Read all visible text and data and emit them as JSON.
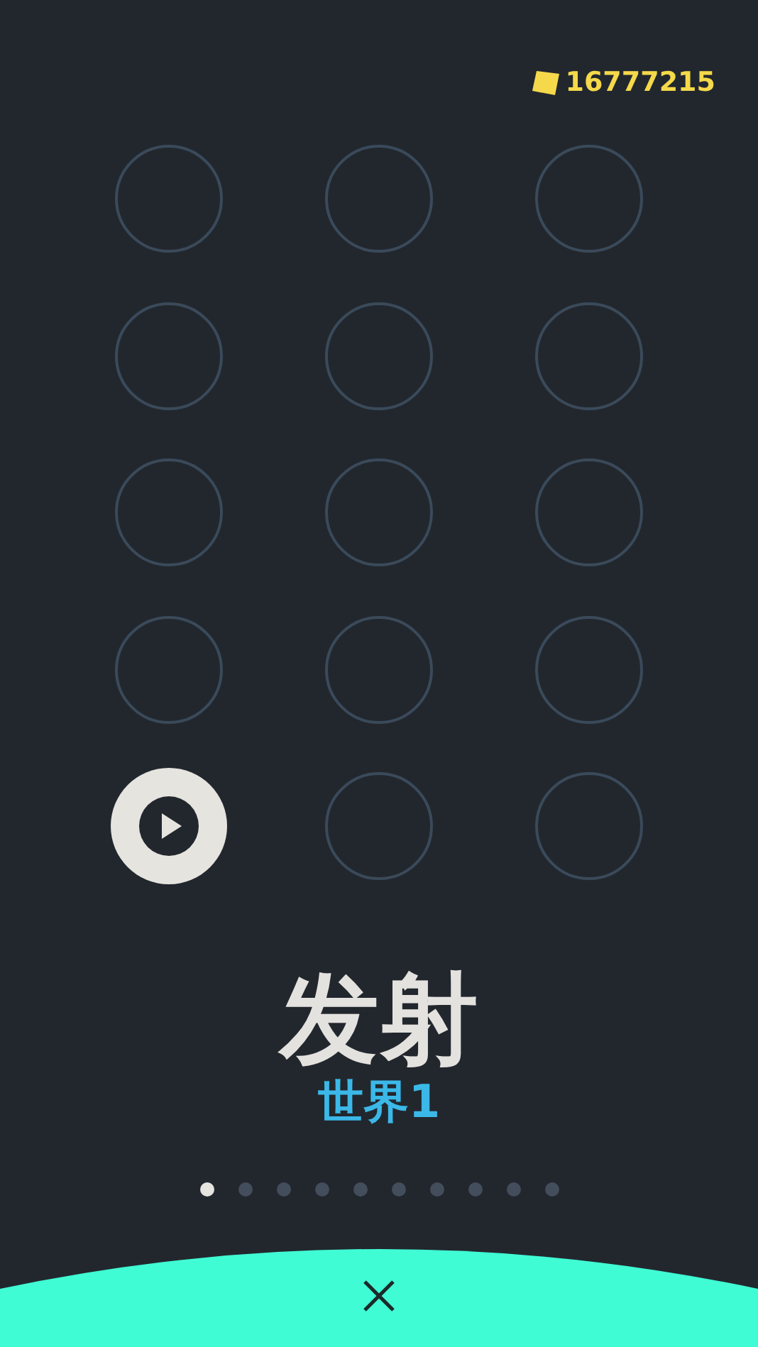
{
  "coins": "16777215",
  "levels": [
    {
      "kind": "locked"
    },
    {
      "kind": "locked"
    },
    {
      "kind": "locked"
    },
    {
      "kind": "locked"
    },
    {
      "kind": "locked"
    },
    {
      "kind": "locked"
    },
    {
      "kind": "locked"
    },
    {
      "kind": "locked"
    },
    {
      "kind": "locked"
    },
    {
      "kind": "locked"
    },
    {
      "kind": "locked"
    },
    {
      "kind": "locked"
    },
    {
      "kind": "unlocked"
    },
    {
      "kind": "locked"
    },
    {
      "kind": "locked"
    }
  ],
  "title": "发射",
  "subtitle": "世界1",
  "pages": [
    {
      "selected": true
    },
    {
      "selected": false
    },
    {
      "selected": false
    },
    {
      "selected": false
    },
    {
      "selected": false
    },
    {
      "selected": false
    },
    {
      "selected": false
    },
    {
      "selected": false
    },
    {
      "selected": false
    },
    {
      "selected": false
    }
  ]
}
